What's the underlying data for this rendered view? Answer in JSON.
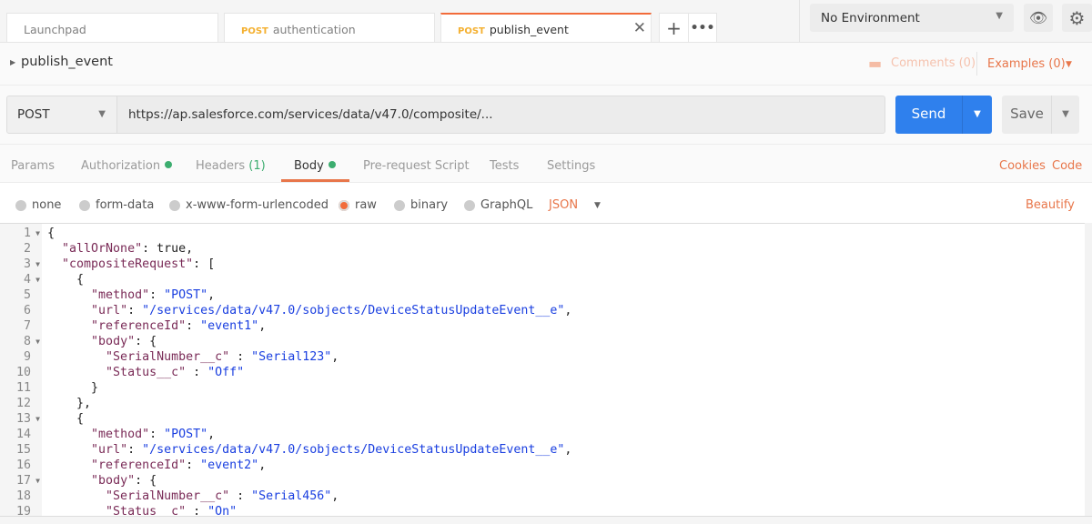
{
  "tabs": [
    {
      "method": "",
      "label": "Launchpad"
    },
    {
      "method": "POST",
      "label": "authentication"
    },
    {
      "method": "POST",
      "label": "publish_event",
      "active": true
    }
  ],
  "environment": {
    "selected": "No Environment"
  },
  "request": {
    "name": "publish_event",
    "comments": "Comments (0)",
    "examples": "Examples (0)",
    "method": "POST",
    "url": "https://ap.salesforce.com/services/data/v47.0/composite/...",
    "send": "Send",
    "save": "Save"
  },
  "req_tabs": [
    {
      "label": "Params"
    },
    {
      "label": "Authorization",
      "dot": true
    },
    {
      "label": "Headers",
      "count": "(1)"
    },
    {
      "label": "Body",
      "dot": true,
      "active": true
    },
    {
      "label": "Pre-request Script"
    },
    {
      "label": "Tests"
    },
    {
      "label": "Settings"
    }
  ],
  "links": {
    "cookies": "Cookies",
    "code": "Code",
    "beautify": "Beautify"
  },
  "body_types": [
    {
      "label": "none"
    },
    {
      "label": "form-data"
    },
    {
      "label": "x-www-form-urlencoded"
    },
    {
      "label": "raw",
      "selected": true
    },
    {
      "label": "binary"
    },
    {
      "label": "GraphQL"
    }
  ],
  "format": "JSON",
  "colors": {
    "accent": "#f26b3a",
    "send": "#2f80ed",
    "key": "#7a2b57",
    "string": "#1a3fe0",
    "dot": "#3cad6f"
  },
  "code": [
    {
      "n": "1",
      "fold": true,
      "t": [
        [
          "p",
          "{"
        ]
      ]
    },
    {
      "n": "2",
      "t": [
        [
          "p",
          "  "
        ],
        [
          "k",
          "\"allOrNone\""
        ],
        [
          "p",
          ": true,"
        ]
      ]
    },
    {
      "n": "3",
      "fold": true,
      "t": [
        [
          "p",
          "  "
        ],
        [
          "k",
          "\"compositeRequest\""
        ],
        [
          "p",
          ": ["
        ]
      ]
    },
    {
      "n": "4",
      "fold": true,
      "t": [
        [
          "p",
          "    {"
        ]
      ]
    },
    {
      "n": "5",
      "t": [
        [
          "p",
          "      "
        ],
        [
          "k",
          "\"method\""
        ],
        [
          "p",
          ": "
        ],
        [
          "s",
          "\"POST\""
        ],
        [
          "p",
          ","
        ]
      ]
    },
    {
      "n": "6",
      "t": [
        [
          "p",
          "      "
        ],
        [
          "k",
          "\"url\""
        ],
        [
          "p",
          ": "
        ],
        [
          "s",
          "\"/services/data/v47.0/sobjects/DeviceStatusUpdateEvent__e\""
        ],
        [
          "p",
          ","
        ]
      ]
    },
    {
      "n": "7",
      "t": [
        [
          "p",
          "      "
        ],
        [
          "k",
          "\"referenceId\""
        ],
        [
          "p",
          ": "
        ],
        [
          "s",
          "\"event1\""
        ],
        [
          "p",
          ","
        ]
      ]
    },
    {
      "n": "8",
      "fold": true,
      "t": [
        [
          "p",
          "      "
        ],
        [
          "k",
          "\"body\""
        ],
        [
          "p",
          ": {"
        ]
      ]
    },
    {
      "n": "9",
      "t": [
        [
          "p",
          "        "
        ],
        [
          "k",
          "\"SerialNumber__c\""
        ],
        [
          "p",
          " : "
        ],
        [
          "s",
          "\"Serial123\""
        ],
        [
          "p",
          ","
        ]
      ]
    },
    {
      "n": "10",
      "t": [
        [
          "p",
          "        "
        ],
        [
          "k",
          "\"Status__c\""
        ],
        [
          "p",
          " : "
        ],
        [
          "s",
          "\"Off\""
        ]
      ]
    },
    {
      "n": "11",
      "t": [
        [
          "p",
          "      }"
        ]
      ]
    },
    {
      "n": "12",
      "t": [
        [
          "p",
          "    },"
        ]
      ]
    },
    {
      "n": "13",
      "fold": true,
      "t": [
        [
          "p",
          "    {"
        ]
      ]
    },
    {
      "n": "14",
      "t": [
        [
          "p",
          "      "
        ],
        [
          "k",
          "\"method\""
        ],
        [
          "p",
          ": "
        ],
        [
          "s",
          "\"POST\""
        ],
        [
          "p",
          ","
        ]
      ]
    },
    {
      "n": "15",
      "t": [
        [
          "p",
          "      "
        ],
        [
          "k",
          "\"url\""
        ],
        [
          "p",
          ": "
        ],
        [
          "s",
          "\"/services/data/v47.0/sobjects/DeviceStatusUpdateEvent__e\""
        ],
        [
          "p",
          ","
        ]
      ]
    },
    {
      "n": "16",
      "t": [
        [
          "p",
          "      "
        ],
        [
          "k",
          "\"referenceId\""
        ],
        [
          "p",
          ": "
        ],
        [
          "s",
          "\"event2\""
        ],
        [
          "p",
          ","
        ]
      ]
    },
    {
      "n": "17",
      "fold": true,
      "t": [
        [
          "p",
          "      "
        ],
        [
          "k",
          "\"body\""
        ],
        [
          "p",
          ": {"
        ]
      ]
    },
    {
      "n": "18",
      "t": [
        [
          "p",
          "        "
        ],
        [
          "k",
          "\"SerialNumber__c\""
        ],
        [
          "p",
          " : "
        ],
        [
          "s",
          "\"Serial456\""
        ],
        [
          "p",
          ","
        ]
      ]
    },
    {
      "n": "19",
      "t": [
        [
          "p",
          "        "
        ],
        [
          "k",
          "\"Status__c\""
        ],
        [
          "p",
          " : "
        ],
        [
          "s",
          "\"On\""
        ]
      ]
    }
  ]
}
